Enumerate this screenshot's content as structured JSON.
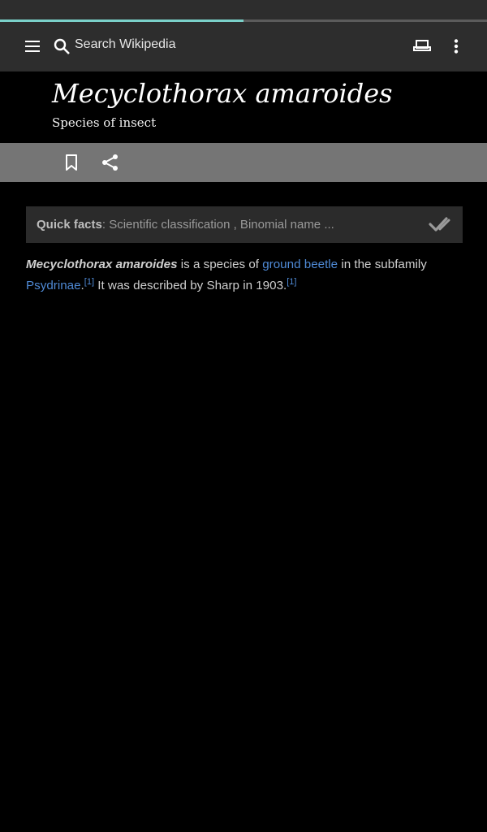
{
  "progress": {
    "fraction": 0.5
  },
  "toolbar": {
    "search_placeholder": "Search Wikipedia",
    "icons": [
      "menu-icon",
      "search-icon",
      "reading-lists-icon",
      "more-vert-icon"
    ]
  },
  "header": {
    "title": "Mecyclothorax amaroides",
    "subtitle": "Species of insect"
  },
  "actions": {
    "icons": [
      "bookmark-icon",
      "share-icon"
    ]
  },
  "quickfacts": {
    "label": "Quick facts",
    "text": ": Scientific classification , Binomial name ...",
    "icon": "expand-check-icon"
  },
  "article": {
    "bold_name": "Mecyclothorax amaroides",
    "t1": " is a species of ",
    "link1": "ground beetle",
    "t2": " in the subfamily ",
    "link2": "Psydrinae",
    "t3": ".",
    "ref1": "[1]",
    "t4": " It was described by Sharp in 1903.",
    "ref2": "[1]"
  },
  "colors": {
    "toolbar_bg": "#2d2d2d",
    "progress": "#7ad0c9",
    "actionbar_bg": "#757575",
    "link": "#4f8ad6",
    "background": "#000000"
  }
}
